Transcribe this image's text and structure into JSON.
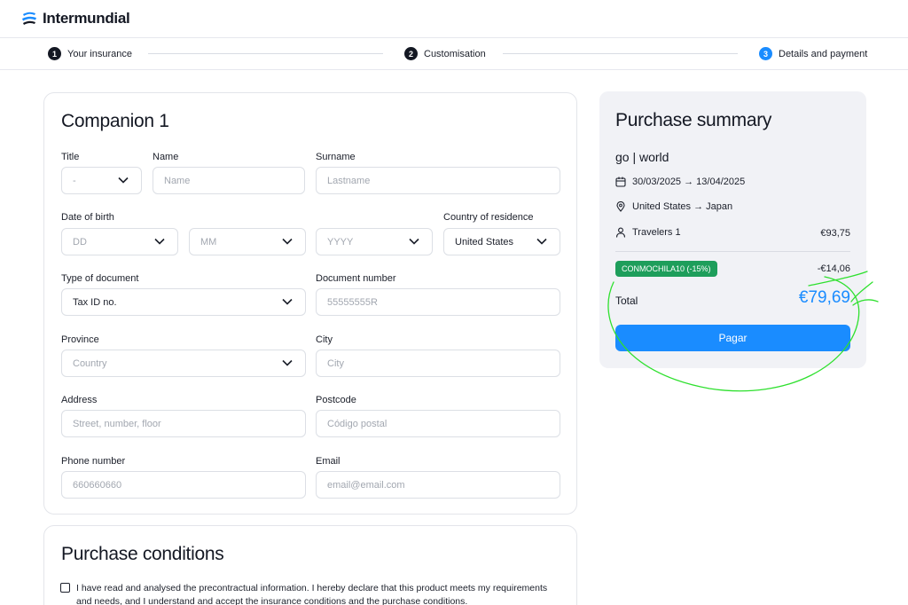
{
  "brand": {
    "name": "Intermundial"
  },
  "steps": [
    {
      "num": "1",
      "label": "Your insurance"
    },
    {
      "num": "2",
      "label": "Customisation"
    },
    {
      "num": "3",
      "label": "Details and payment"
    }
  ],
  "companion": {
    "title": "Companion 1",
    "fields": {
      "title_label": "Title",
      "title_value": "-",
      "name_label": "Name",
      "name_placeholder": "Name",
      "surname_label": "Surname",
      "surname_placeholder": "Lastname",
      "dob_label": "Date of birth",
      "dob_day": "DD",
      "dob_month": "MM",
      "dob_year": "YYYY",
      "country_label": "Country of residence",
      "country_value": "United States",
      "doc_type_label": "Type of document",
      "doc_type_value": "Tax ID no.",
      "doc_num_label": "Document number",
      "doc_num_placeholder": "55555555R",
      "province_label": "Province",
      "province_placeholder": "Country",
      "city_label": "City",
      "city_placeholder": "City",
      "address_label": "Address",
      "address_placeholder": "Street, number, floor",
      "postcode_label": "Postcode",
      "postcode_placeholder": "Código postal",
      "phone_label": "Phone number",
      "phone_placeholder": "660660660",
      "email_label": "Email",
      "email_placeholder": "email@email.com"
    }
  },
  "conditions": {
    "title": "Purchase conditions",
    "text": "I have read and analysed the precontractual information. I hereby declare that this product meets my requirements and needs, and I understand and accept the insurance conditions and the purchase conditions."
  },
  "summary": {
    "title": "Purchase summary",
    "product": "go | world",
    "dates": "30/03/2025 → 13/04/2025",
    "route": "United States → Japan",
    "travelers": "Travelers 1",
    "travelers_amount": "€93,75",
    "promo_code": "CONMOCHILA10 (-15%)",
    "discount": "-€14,06",
    "total_label": "Total",
    "total_value": "€79,69",
    "pay_label": "Pagar"
  },
  "colors": {
    "accent": "#1a8cff",
    "promo": "#1e9e5b",
    "annotation": "#2ee02e"
  }
}
